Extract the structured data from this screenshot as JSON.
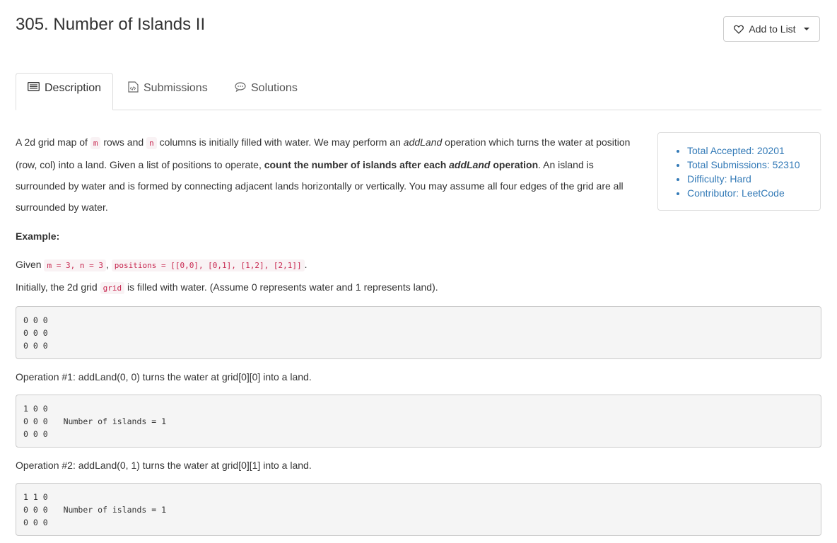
{
  "problem": {
    "title": "305. Number of Islands II",
    "add_to_list": "Add to List"
  },
  "tabs": [
    {
      "label": "Description",
      "icon": "description-icon",
      "active": true
    },
    {
      "label": "Submissions",
      "icon": "submissions-icon",
      "active": false
    },
    {
      "label": "Solutions",
      "icon": "solutions-icon",
      "active": false
    }
  ],
  "stats": {
    "accepted": "Total Accepted: 20201",
    "submissions": "Total Submissions: 52310",
    "difficulty": "Difficulty: Hard",
    "contributor": "Contributor: LeetCode"
  },
  "description": {
    "p1_a": "A 2d grid map of ",
    "m": "m",
    "p1_b": " rows and ",
    "n": "n",
    "p1_c": " columns is initially filled with water. We may perform an ",
    "addland": "addLand",
    "p1_d": " operation which turns the water at position (row, col) into a land. Given a list of positions to operate, ",
    "bold_a": "count the number of islands after each ",
    "bold_b": "addLand",
    "bold_c": " operation",
    "p1_e": ". An island is surrounded by water and is formed by connecting adjacent lands horizontally or vertically. You may assume all four edges of the grid are all surrounded by water."
  },
  "example": {
    "heading": "Example:",
    "given_label": "Given ",
    "given_code_1": "m = 3, n = 3",
    "given_sep": ", ",
    "given_code_2": "positions = [[0,0], [0,1], [1,2], [2,1]]",
    "given_end": ".",
    "initial_a": "Initially, the 2d grid ",
    "initial_code": "grid",
    "initial_b": " is filled with water. (Assume 0 represents water and 1 represents land).",
    "grid0": [
      "0 0 0",
      "0 0 0",
      "0 0 0"
    ],
    "op1": "Operation #1: addLand(0, 0) turns the water at grid[0][0] into a land.",
    "grid1": [
      "1 0 0",
      "0 0 0",
      "0 0 0"
    ],
    "grid1_note": "Number of islands = 1",
    "op2": "Operation #2: addLand(0, 1) turns the water at grid[0][1] into a land.",
    "grid2": [
      "1 1 0",
      "0 0 0",
      "0 0 0"
    ],
    "grid2_note": "Number of islands = 1"
  },
  "colors": {
    "link": "#337ab7",
    "code_text": "#c7254e",
    "code_bg": "#f9f2f4",
    "pre_bg": "#f5f5f5"
  }
}
